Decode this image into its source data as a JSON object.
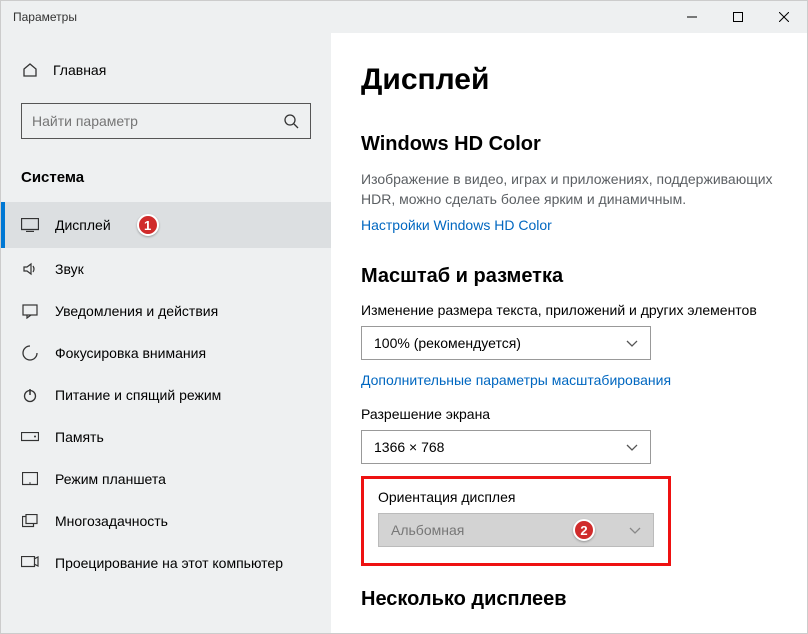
{
  "window": {
    "title": "Параметры"
  },
  "sidebar": {
    "home": "Главная",
    "search_placeholder": "Найти параметр",
    "section": "Система",
    "items": [
      {
        "label": "Дисплей"
      },
      {
        "label": "Звук"
      },
      {
        "label": "Уведомления и действия"
      },
      {
        "label": "Фокусировка внимания"
      },
      {
        "label": "Питание и спящий режим"
      },
      {
        "label": "Память"
      },
      {
        "label": "Режим планшета"
      },
      {
        "label": "Многозадачность"
      },
      {
        "label": "Проецирование на этот компьютер"
      }
    ]
  },
  "main": {
    "title": "Дисплей",
    "hd": {
      "heading": "Windows HD Color",
      "desc": "Изображение в видео, играх и приложениях, поддерживающих HDR, можно сделать более ярким и динамичным.",
      "link": "Настройки Windows HD Color"
    },
    "scale": {
      "heading": "Масштаб и разметка",
      "label": "Изменение размера текста, приложений и других элементов",
      "value": "100% (рекомендуется)",
      "advanced": "Дополнительные параметры масштабирования"
    },
    "resolution": {
      "label": "Разрешение экрана",
      "value": "1366 × 768"
    },
    "orientation": {
      "label": "Ориентация дисплея",
      "value": "Альбомная"
    },
    "multi": "Несколько дисплеев"
  },
  "annotations": {
    "b1": "1",
    "b2": "2"
  }
}
